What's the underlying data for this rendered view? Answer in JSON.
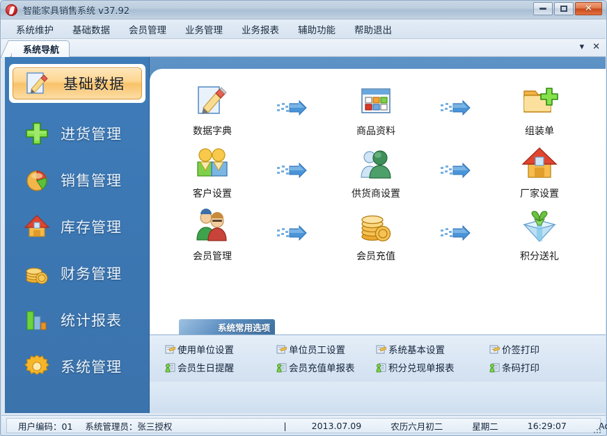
{
  "window": {
    "title": "智能家具销售系统 v37.92",
    "app_icon": "app-logo-icon",
    "minimize_label": "Minimize",
    "maximize_label": "Maximize",
    "close_label": "✕"
  },
  "menubar": {
    "items": [
      {
        "label": "系统维护",
        "name": "menu-system-maintenance"
      },
      {
        "label": "基础数据",
        "name": "menu-basic-data"
      },
      {
        "label": "会员管理",
        "name": "menu-member-management"
      },
      {
        "label": "业务管理",
        "name": "menu-business-management"
      },
      {
        "label": "业务报表",
        "name": "menu-business-report"
      },
      {
        "label": "辅助功能",
        "name": "menu-aux-functions"
      },
      {
        "label": "帮助退出",
        "name": "menu-help-exit"
      }
    ]
  },
  "tabstrip": {
    "active_tab": "系统导航",
    "dropdown_glyph": "▾",
    "close_glyph": "✕"
  },
  "sidebar": {
    "selected_index": 0,
    "items": [
      {
        "label": "基础数据",
        "icon": "pencil-document-icon",
        "selected": true
      },
      {
        "label": "进货管理",
        "icon": "green-plus-icon",
        "selected": false
      },
      {
        "label": "销售管理",
        "icon": "pie-chart-icon",
        "selected": false
      },
      {
        "label": "库存管理",
        "icon": "house-icon",
        "selected": false
      },
      {
        "label": "财务管理",
        "icon": "coin-stack-icon",
        "selected": false
      },
      {
        "label": "统计报表",
        "icon": "bar-chart-icon",
        "selected": false
      },
      {
        "label": "系统管理",
        "icon": "gear-icon",
        "selected": false
      }
    ]
  },
  "main": {
    "rows": [
      {
        "cells": [
          {
            "label": "数据字典",
            "icon": "pencil-document-icon"
          },
          {
            "label": "商品资料",
            "icon": "product-grid-icon"
          },
          {
            "label": "组装单",
            "icon": "folder-plus-icon"
          }
        ]
      },
      {
        "cells": [
          {
            "label": "客户设置",
            "icon": "two-people-icon"
          },
          {
            "label": "供货商设置",
            "icon": "supplier-people-icon"
          },
          {
            "label": "厂家设置",
            "icon": "factory-house-icon"
          }
        ]
      },
      {
        "cells": [
          {
            "label": "会员管理",
            "icon": "member-people-icon"
          },
          {
            "label": "会员充值",
            "icon": "coin-stack-icon"
          },
          {
            "label": "积分送礼",
            "icon": "gift-box-icon"
          }
        ]
      }
    ],
    "arrow_icon": "blue-arrow-right-icon"
  },
  "options": {
    "header": "系统常用选项",
    "links": [
      {
        "label": "使用单位设置",
        "icon": "settings-doc-icon"
      },
      {
        "label": "单位员工设置",
        "icon": "settings-doc-icon"
      },
      {
        "label": "系统基本设置",
        "icon": "settings-doc-icon"
      },
      {
        "label": "价签打印",
        "icon": "settings-doc-icon"
      },
      {
        "label": "会员生日提醒",
        "icon": "person-report-icon"
      },
      {
        "label": "会员充值单报表",
        "icon": "person-report-icon"
      },
      {
        "label": "积分兑现单报表",
        "icon": "person-report-icon"
      },
      {
        "label": "条码打印",
        "icon": "person-report-icon"
      }
    ]
  },
  "statusbar": {
    "user": "用户编码：01",
    "admin": "系统管理员：张三授权",
    "separator": "|",
    "date": "2013.07.09",
    "lunar": "农历六月初二",
    "weekday": "星期二",
    "time": "16:29:07",
    "database": "Access"
  },
  "colors": {
    "sidebar_blue": "#3c78b4",
    "accent_orange": "#f9c269",
    "title_blue": "#19324e",
    "content_blue": "#5e93c6"
  }
}
